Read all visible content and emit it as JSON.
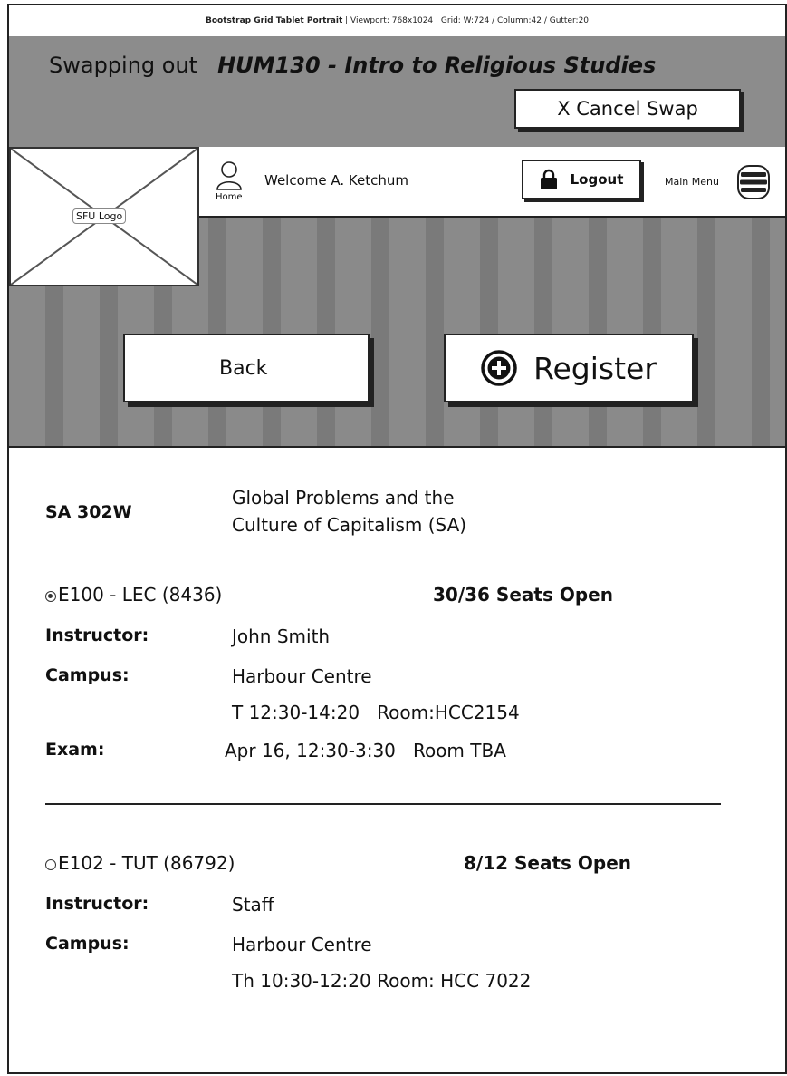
{
  "annotation": {
    "title": "Bootstrap Grid Tablet Portrait",
    "details": "  |  Viewport: 768x1024  |  Grid: W:724 / Column:42 / Gutter:20"
  },
  "swap": {
    "prefix": "Swapping out",
    "course": "HUM130 - Intro to Religious Studies",
    "cancel_label": "X Cancel Swap"
  },
  "logo": {
    "label": "SFU Logo"
  },
  "nav": {
    "home_label": "Home",
    "welcome": "Welcome A. Ketchum",
    "logout_label": "Logout",
    "menu_label": "Main Menu"
  },
  "actions": {
    "back_label": "Back",
    "register_label": "Register"
  },
  "course": {
    "code": "SA 302W",
    "title_line1": "Global Problems and the",
    "title_line2": "Culture of Capitalism (SA)"
  },
  "sections": [
    {
      "name": "E100 - LEC (8436)",
      "selected": true,
      "seats": "30/36 Seats Open",
      "instructor_label": "Instructor:",
      "instructor": "John Smith",
      "campus_label": "Campus:",
      "campus": "Harbour Centre",
      "schedule": "T 12:30-14:20   Room:HCC2154",
      "exam_label": "Exam:",
      "exam": "Apr 16, 12:30-3:30   Room TBA"
    },
    {
      "name": "E102 - TUT (86792)",
      "selected": false,
      "seats": "8/12 Seats Open",
      "instructor_label": "Instructor:",
      "instructor": "Staff",
      "campus_label": "Campus:",
      "campus": "Harbour Centre",
      "schedule": "Th 10:30-12:20 Room: HCC 7022"
    }
  ]
}
